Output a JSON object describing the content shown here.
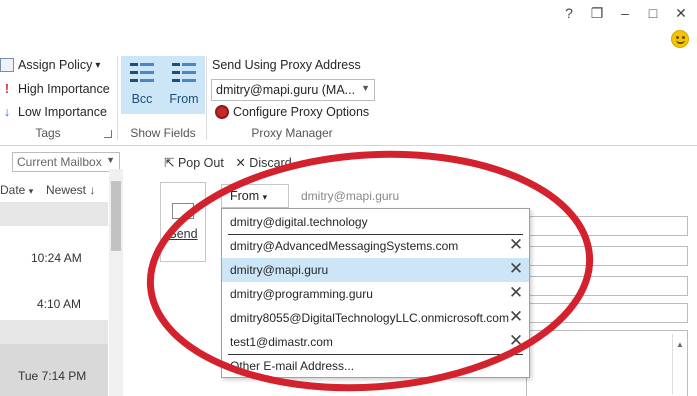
{
  "window": {
    "help_icon": "?",
    "restore_icon": "❐",
    "minimize_icon": "–",
    "maximize_icon": "□",
    "close_icon": "✕"
  },
  "ribbon": {
    "tags": {
      "assign_policy": "Assign Policy",
      "assign_policy_arrow": "▾",
      "high_importance": "High Importance",
      "low_importance": "Low Importance",
      "group_label": "Tags"
    },
    "show_fields": {
      "bcc": "Bcc",
      "from": "From",
      "group_label": "Show Fields"
    },
    "proxy_manager": {
      "title": "Send Using Proxy Address",
      "selected_address": "dmitry@mapi.guru (MA...",
      "configure": "Configure Proxy Options",
      "group_label": "Proxy Manager"
    }
  },
  "mail_list": {
    "mailbox_scope": "Current Mailbox",
    "sort_by": "Date",
    "sort_order": "Newest",
    "times": [
      "10:24 AM",
      "4:10 AM",
      "Tue 7:14 PM"
    ]
  },
  "compose": {
    "pop_out": "Pop Out",
    "discard": "Discard",
    "send": "Send",
    "from_button": "From",
    "from_value": "dmitry@mapi.guru"
  },
  "from_dropdown": {
    "items": [
      {
        "address": "dmitry@digital.technology",
        "removable": false,
        "selected": false
      },
      {
        "address": "dmitry@AdvancedMessagingSystems.com",
        "removable": true,
        "selected": false
      },
      {
        "address": "dmitry@mapi.guru",
        "removable": true,
        "selected": true
      },
      {
        "address": "dmitry@programming.guru",
        "removable": true,
        "selected": false
      },
      {
        "address": "dmitry8055@DigitalTechnologyLLC.onmicrosoft.com",
        "removable": true,
        "selected": false
      },
      {
        "address": "test1@dimastr.com",
        "removable": true,
        "selected": false
      }
    ],
    "other_address": "Other E-mail Address...",
    "remove_icon": "✕"
  },
  "colors": {
    "selection": "#cde6f7",
    "annotation_ellipse": "#d3212d",
    "accent": "#4a86c6"
  }
}
